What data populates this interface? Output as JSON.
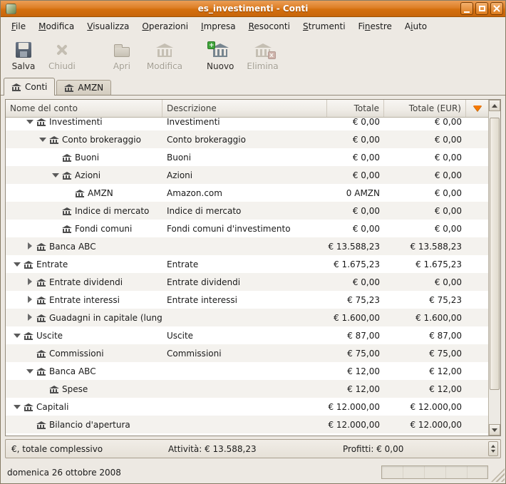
{
  "window": {
    "title": "es_investimenti - Conti",
    "controls": [
      "minimize-icon",
      "maximize-icon",
      "close-icon"
    ]
  },
  "menu": {
    "items": [
      {
        "label": "File",
        "accel": 0
      },
      {
        "label": "Modifica",
        "accel": 0
      },
      {
        "label": "Visualizza",
        "accel": 0
      },
      {
        "label": "Operazioni",
        "accel": 0
      },
      {
        "label": "Impresa",
        "accel": 0
      },
      {
        "label": "Resoconti",
        "accel": 0
      },
      {
        "label": "Strumenti",
        "accel": 0
      },
      {
        "label": "Finestre",
        "accel": 2
      },
      {
        "label": "Aiuto",
        "accel": 1
      }
    ]
  },
  "toolbar": {
    "buttons": [
      {
        "label": "Salva",
        "icon": "save-icon",
        "enabled": true
      },
      {
        "label": "Chiudi",
        "icon": "close-page-icon",
        "enabled": false
      },
      {
        "label": "Apri",
        "icon": "open-icon",
        "enabled": false
      },
      {
        "label": "Modifica",
        "icon": "edit-account-icon",
        "enabled": false
      },
      {
        "label": "Nuovo",
        "icon": "new-account-icon",
        "enabled": true,
        "badge": "+"
      },
      {
        "label": "Elimina",
        "icon": "delete-account-icon",
        "enabled": false,
        "badge": "x"
      }
    ]
  },
  "tabs": [
    {
      "label": "Conti",
      "active": true
    },
    {
      "label": "AMZN",
      "active": false
    }
  ],
  "accounts": {
    "columns": [
      "Nome del conto",
      "Descrizione",
      "Totale",
      "Totale (EUR)"
    ],
    "rows": [
      {
        "name": "Investimenti",
        "desc": "Investimenti",
        "total": "€ 0,00",
        "total_eur": "€ 0,00",
        "level": 2,
        "expander": "expanded"
      },
      {
        "name": "Conto brokeraggio",
        "desc": "Conto brokeraggio",
        "total": "€ 0,00",
        "total_eur": "€ 0,00",
        "level": 3,
        "expander": "expanded"
      },
      {
        "name": "Buoni",
        "desc": "Buoni",
        "total": "€ 0,00",
        "total_eur": "€ 0,00",
        "level": 4,
        "expander": "none"
      },
      {
        "name": "Azioni",
        "desc": "Azioni",
        "total": "€ 0,00",
        "total_eur": "€ 0,00",
        "level": 4,
        "expander": "expanded"
      },
      {
        "name": "AMZN",
        "desc": "Amazon.com",
        "total": "0 AMZN",
        "total_eur": "€ 0,00",
        "level": 5,
        "expander": "none"
      },
      {
        "name": "Indice di mercato",
        "desc": "Indice di mercato",
        "total": "€ 0,00",
        "total_eur": "€ 0,00",
        "level": 4,
        "expander": "none"
      },
      {
        "name": "Fondi comuni",
        "desc": "Fondi comuni d'investimento",
        "total": "€ 0,00",
        "total_eur": "€ 0,00",
        "level": 4,
        "expander": "none"
      },
      {
        "name": "Banca ABC",
        "desc": "",
        "total": "€ 13.588,23",
        "total_eur": "€ 13.588,23",
        "level": 2,
        "expander": "collapsed"
      },
      {
        "name": "Entrate",
        "desc": "Entrate",
        "total": "€ 1.675,23",
        "total_eur": "€ 1.675,23",
        "level": 1,
        "expander": "expanded"
      },
      {
        "name": "Entrate dividendi",
        "desc": "Entrate dividendi",
        "total": "€ 0,00",
        "total_eur": "€ 0,00",
        "level": 2,
        "expander": "collapsed"
      },
      {
        "name": "Entrate interessi",
        "desc": "Entrate interessi",
        "total": "€ 75,23",
        "total_eur": "€ 75,23",
        "level": 2,
        "expander": "collapsed"
      },
      {
        "name": "Guadagni in capitale (lung",
        "desc": "",
        "total": "€ 1.600,00",
        "total_eur": "€ 1.600,00",
        "level": 2,
        "expander": "collapsed"
      },
      {
        "name": "Uscite",
        "desc": "Uscite",
        "total": "€ 87,00",
        "total_eur": "€ 87,00",
        "level": 1,
        "expander": "expanded"
      },
      {
        "name": "Commissioni",
        "desc": "Commissioni",
        "total": "€ 75,00",
        "total_eur": "€ 75,00",
        "level": 2,
        "expander": "none"
      },
      {
        "name": "Banca ABC",
        "desc": "",
        "total": "€ 12,00",
        "total_eur": "€ 12,00",
        "level": 2,
        "expander": "expanded"
      },
      {
        "name": "Spese",
        "desc": "",
        "total": "€ 12,00",
        "total_eur": "€ 12,00",
        "level": 3,
        "expander": "none"
      },
      {
        "name": "Capitali",
        "desc": "",
        "total": "€ 12.000,00",
        "total_eur": "€ 12.000,00",
        "level": 1,
        "expander": "expanded"
      },
      {
        "name": "Bilancio d'apertura",
        "desc": "",
        "total": "€ 12.000,00",
        "total_eur": "€ 12.000,00",
        "level": 2,
        "expander": "none"
      }
    ]
  },
  "summary": {
    "total_label": "€, totale complessivo",
    "assets": "Attività: € 13.588,23",
    "profits": "Profitti: € 0,00"
  },
  "status": {
    "date": "domenica 26 ottobre 2008"
  },
  "colors": {
    "titlebar_orange": "#D4700F",
    "accent_orange": "#F57900",
    "row_alt": "#F4F2EE",
    "window_bg": "#EDE9E3"
  }
}
